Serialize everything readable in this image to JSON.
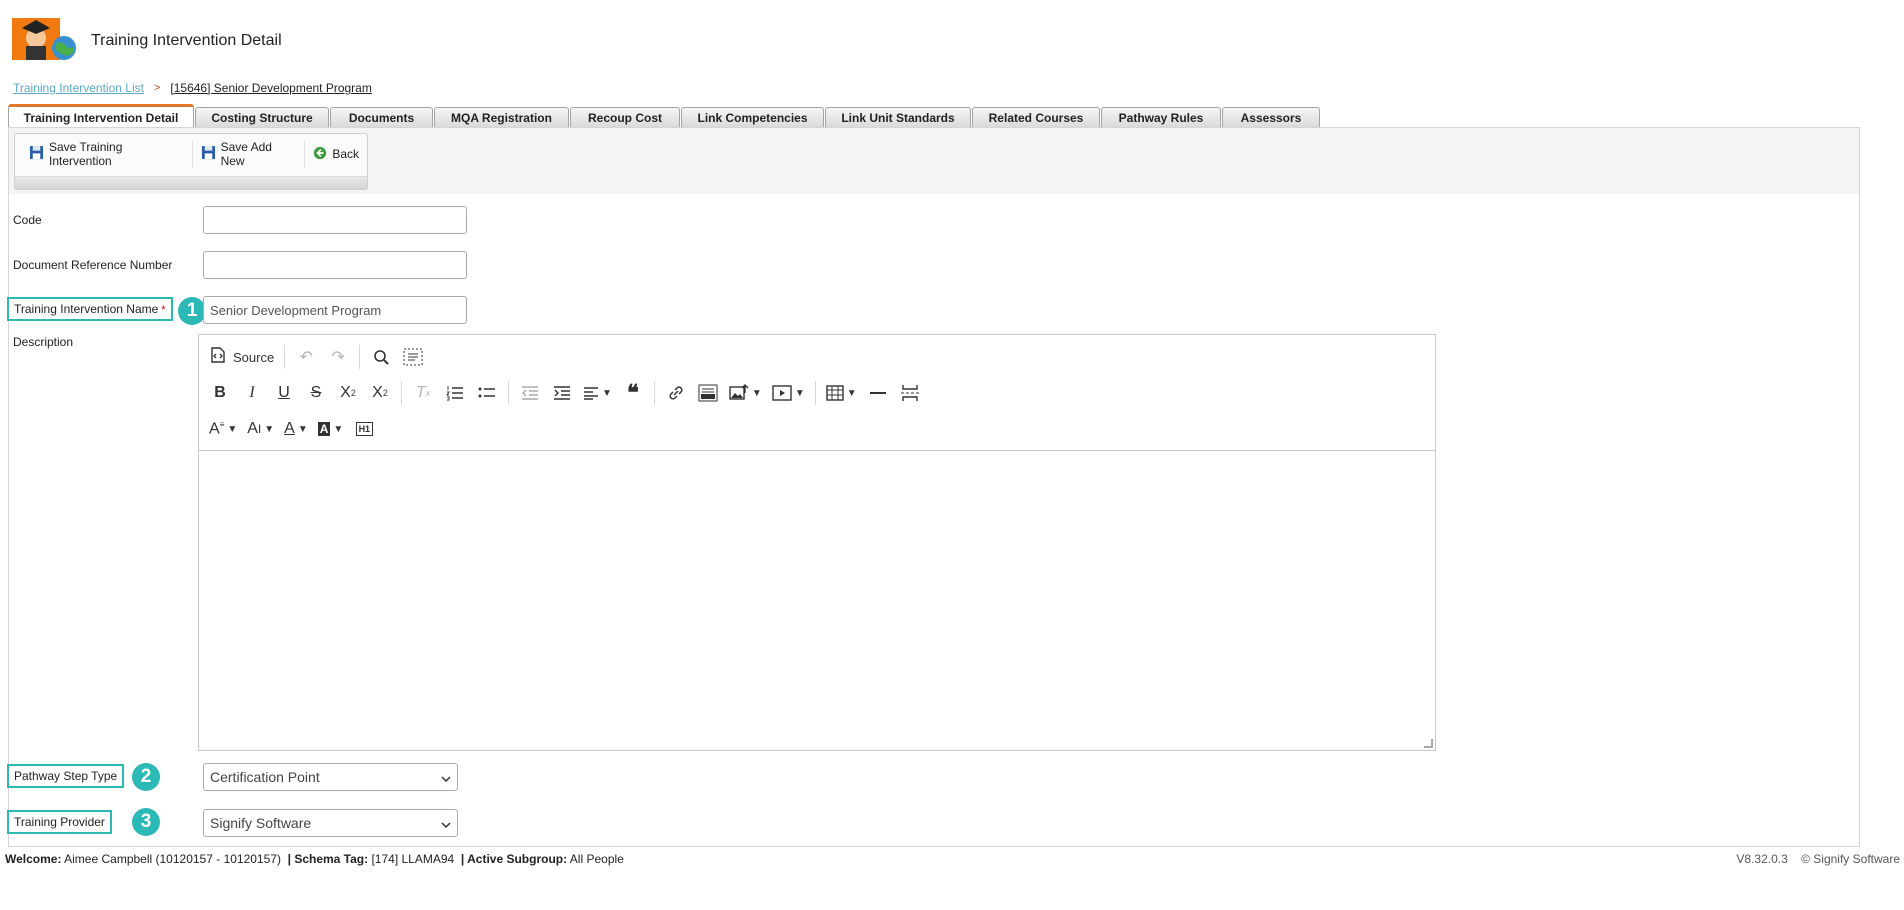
{
  "header": {
    "title": "Training Intervention Detail"
  },
  "breadcrumb": {
    "list_link": "Training Intervention List",
    "separator": ">",
    "current": "[15646] Senior Development Program"
  },
  "tabs": [
    {
      "label": "Training Intervention Detail"
    },
    {
      "label": "Costing Structure"
    },
    {
      "label": "Documents"
    },
    {
      "label": "MQA Registration"
    },
    {
      "label": "Recoup Cost"
    },
    {
      "label": "Link Competencies"
    },
    {
      "label": "Link Unit Standards"
    },
    {
      "label": "Related Courses"
    },
    {
      "label": "Pathway Rules"
    },
    {
      "label": "Assessors"
    }
  ],
  "toolbar": {
    "save_label": "Save Training Intervention",
    "save_add_label": "Save Add New",
    "back_label": "Back"
  },
  "form": {
    "code": {
      "label": "Code",
      "value": ""
    },
    "doc_ref": {
      "label": "Document Reference Number",
      "value": ""
    },
    "name": {
      "label": "Training Intervention Name",
      "required_mark": "*",
      "value": "Senior Development Program",
      "badge": "1"
    },
    "description": {
      "label": "Description",
      "source_label": "Source"
    },
    "pathway_step_type": {
      "label": "Pathway Step Type",
      "value": "Certification Point",
      "badge": "2"
    },
    "training_provider": {
      "label": "Training Provider",
      "value": "Signify Software",
      "badge": "3"
    }
  },
  "footer": {
    "welcome_label": "Welcome:",
    "welcome_value": "Aimee Campbell (10120157 - 10120157)",
    "schema_label": "| Schema Tag:",
    "schema_value": "[174] LLAMA94",
    "subgroup_label": "| Active Subgroup:",
    "subgroup_value": "All People",
    "version": "V8.32.0.3",
    "copyright": "© Signify Software"
  },
  "colors": {
    "accent": "#2cb9b5",
    "tab_active_border": "#e07a2a",
    "link": "#5aa9c9"
  }
}
